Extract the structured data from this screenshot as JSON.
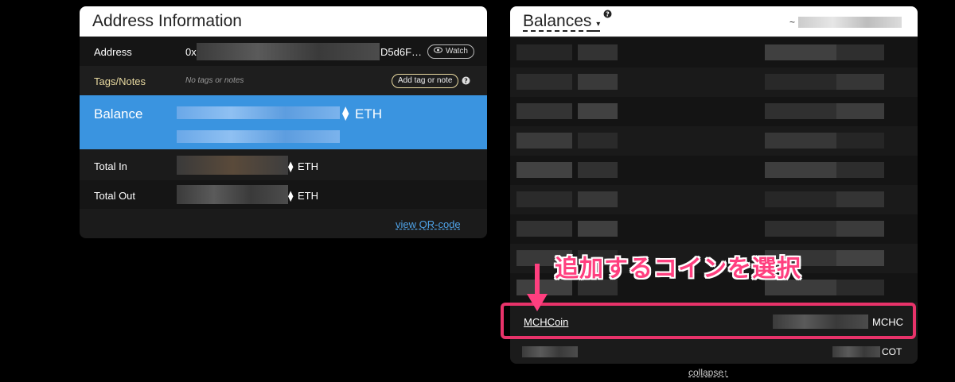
{
  "address_panel": {
    "title": "Address Information",
    "address_label": "Address",
    "address_prefix": "0x",
    "address_suffix": "D5d6F…",
    "watch_label": "Watch",
    "tags_label": "Tags/Notes",
    "tags_value": "No tags or notes",
    "add_tag_label": "Add tag or note",
    "balance_label": "Balance",
    "balance_unit": "ETH",
    "total_in_label": "Total In",
    "total_in_unit": "ETH",
    "total_out_label": "Total Out",
    "total_out_unit": "ETH",
    "qr_link": "view QR-code"
  },
  "balances_panel": {
    "title": "Balances",
    "approx_prefix": "~",
    "highlight_token": {
      "name": "MCHCoin",
      "symbol": "MCHC"
    },
    "next_token_symbol": "COT",
    "collapse_label": "collapse↑"
  },
  "annotation": {
    "callout_text": "追加するコインを選択",
    "highlight_color": "#e8336a"
  },
  "colors": {
    "balance_row": "#3a94e0",
    "link": "#4fa3e8"
  },
  "icons": [
    "eye-icon",
    "help-icon",
    "ethereum-icon",
    "caret-down-icon",
    "arrow-down-icon"
  ]
}
